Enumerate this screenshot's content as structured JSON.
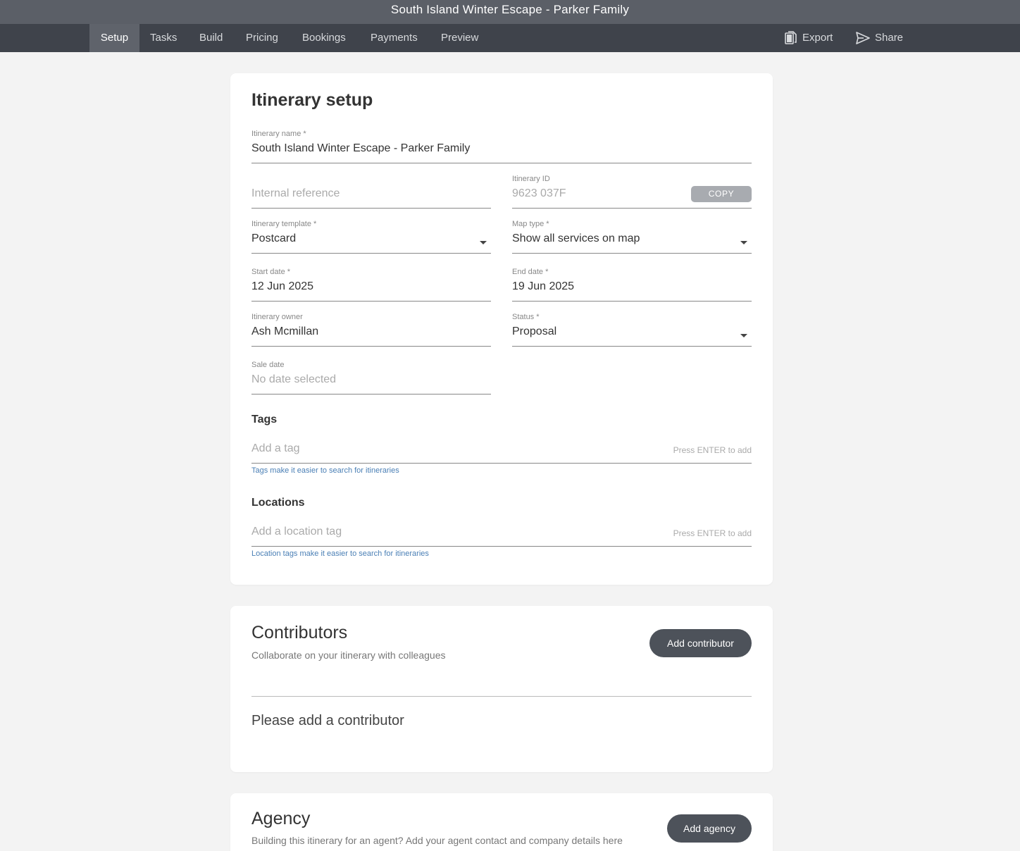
{
  "window": {
    "title": "South Island Winter Escape - Parker Family"
  },
  "nav": {
    "tabs": [
      {
        "label": "Setup"
      },
      {
        "label": "Tasks"
      },
      {
        "label": "Build"
      },
      {
        "label": "Pricing"
      },
      {
        "label": "Bookings"
      },
      {
        "label": "Payments"
      },
      {
        "label": "Preview"
      }
    ],
    "active_tab": "Setup",
    "export_label": "Export",
    "share_label": "Share"
  },
  "setup": {
    "heading": "Itinerary setup",
    "itinerary_name": {
      "label": "Itinerary name *",
      "value": "South Island Winter Escape - Parker Family"
    },
    "internal_reference": {
      "placeholder": "Internal reference"
    },
    "itinerary_id": {
      "label": "Itinerary ID",
      "value": "9623 037F",
      "copy_label": "COPY"
    },
    "template": {
      "label": "Itinerary template *",
      "value": "Postcard"
    },
    "map_type": {
      "label": "Map type *",
      "value": "Show all services on map"
    },
    "start_date": {
      "label": "Start date *",
      "value": "12 Jun 2025"
    },
    "end_date": {
      "label": "End date *",
      "value": "19 Jun 2025"
    },
    "owner": {
      "label": "Itinerary owner",
      "value": "Ash Mcmillan"
    },
    "status": {
      "label": "Status *",
      "value": "Proposal"
    },
    "sale_date": {
      "label": "Sale date",
      "placeholder": "No date selected"
    },
    "tags": {
      "heading": "Tags",
      "placeholder": "Add a tag",
      "hint": "Press ENTER to add",
      "helper": "Tags make it easier to search for itineraries"
    },
    "locations": {
      "heading": "Locations",
      "placeholder": "Add a location tag",
      "hint": "Press ENTER to add",
      "helper": "Location tags make it easier to search for itineraries"
    }
  },
  "contributors": {
    "heading": "Contributors",
    "subtitle": "Collaborate on your itinerary with colleagues",
    "add_label": "Add contributor",
    "empty_message": "Please add a contributor"
  },
  "agency": {
    "heading": "Agency",
    "subtitle": "Building this itinerary for an agent? Add your agent contact and company details here",
    "add_label": "Add agency"
  },
  "colors": {
    "titlebar": "#5b5f67",
    "navbar": "#3f434b",
    "nav_active": "#5f636b",
    "button_dark": "#4d525a",
    "helper_text": "#4a7fb5"
  }
}
